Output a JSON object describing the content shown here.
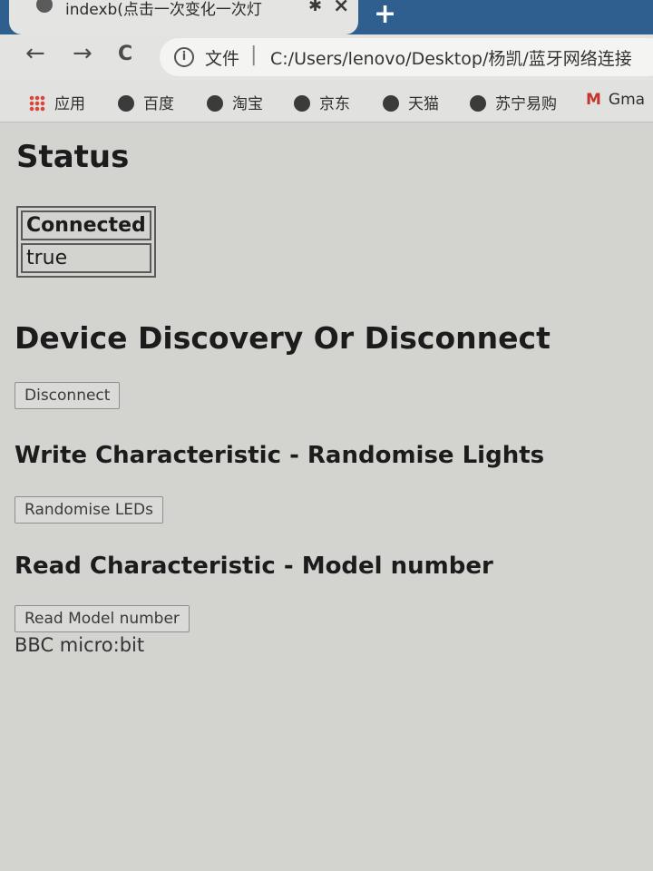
{
  "browser": {
    "tab": {
      "title": "indexb(点击一次变化一次灯",
      "bluetooth_icon": "bluetooth-icon",
      "close_label": "×",
      "new_tab_label": "+"
    },
    "nav": {
      "back": "←",
      "forward": "→",
      "reload": "C"
    },
    "omnibox": {
      "info_icon": "ⓘ",
      "scheme_label": "文件",
      "separator": "|",
      "url": "C:/Users/lenovo/Desktop/杨凯/蓝牙网络连接"
    },
    "bookmarks": [
      {
        "label": "应用",
        "icon": "apps-grid-icon"
      },
      {
        "label": "百度",
        "icon": "globe-icon"
      },
      {
        "label": "淘宝",
        "icon": "globe-icon"
      },
      {
        "label": "京东",
        "icon": "globe-icon"
      },
      {
        "label": "天猫",
        "icon": "globe-icon"
      },
      {
        "label": "苏宁易购",
        "icon": "globe-icon"
      },
      {
        "label": "Gma",
        "icon": "gmail-icon"
      }
    ]
  },
  "page": {
    "status": {
      "title": "Status",
      "table_header": "Connected",
      "table_value": "true"
    },
    "discovery": {
      "title": "Device Discovery Or Disconnect",
      "button_label": "Disconnect"
    },
    "write": {
      "title": "Write Characteristic - Randomise Lights",
      "button_label": "Randomise LEDs"
    },
    "read": {
      "title": "Read Characteristic - Model number",
      "button_label": "Read Model number",
      "result": "BBC micro:bit"
    }
  }
}
